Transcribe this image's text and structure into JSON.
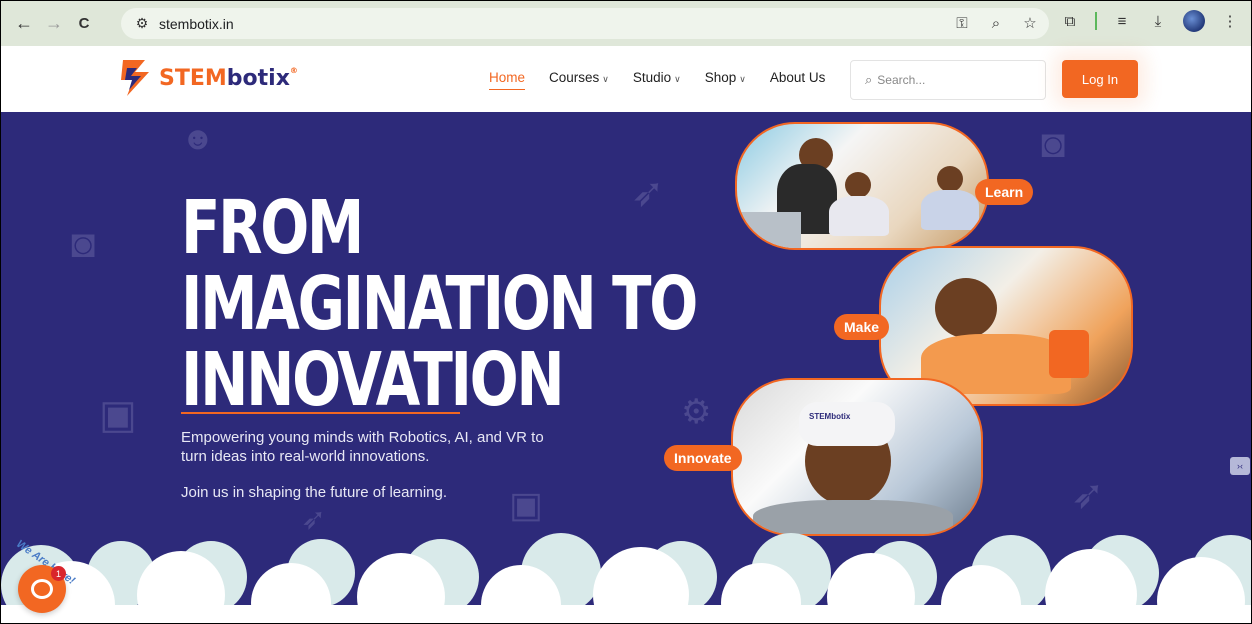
{
  "browser": {
    "url": "stembotix.in",
    "back_icon": "←",
    "forward_icon": "→",
    "reload_icon": "C"
  },
  "site": {
    "logo_text_1": "STEM",
    "logo_text_2": "botix",
    "logo_reg": "®",
    "nav": [
      {
        "label": "Home",
        "active": true
      },
      {
        "label": "Courses",
        "dropdown": true
      },
      {
        "label": "Studio",
        "dropdown": true
      },
      {
        "label": "Shop",
        "dropdown": true
      },
      {
        "label": "About Us"
      }
    ],
    "search_placeholder": "Search...",
    "login_label": "Log In"
  },
  "hero": {
    "headline_1": "FROM",
    "headline_2": "IMAGINATION TO",
    "headline_3": "INNOVATION",
    "subtext": "Empowering young minds with Robotics, AI, and VR to turn ideas into real-world innovations.",
    "subtext2": "Join us in shaping the future of learning.",
    "tags": [
      "Learn",
      "Make",
      "Innovate"
    ],
    "headset_brand": "STEMbotix"
  },
  "chat": {
    "badge_text": "We Are Here!",
    "unread_count": "1"
  },
  "colors": {
    "brand_orange": "#f26722",
    "brand_navy": "#2d2a7a"
  }
}
